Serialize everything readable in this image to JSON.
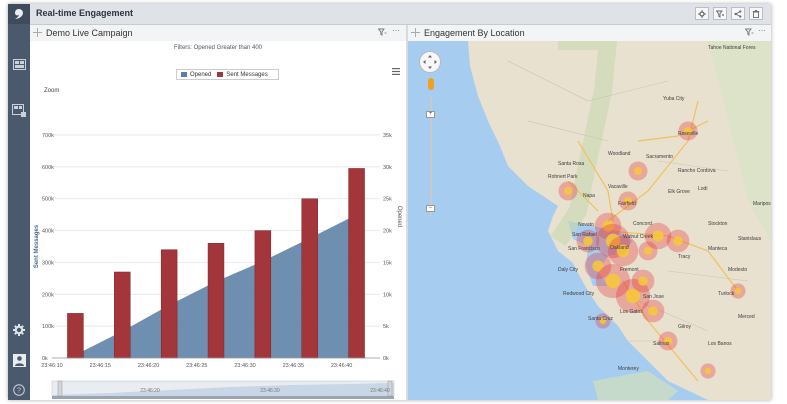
{
  "app": {
    "title": "Real-time Engagement"
  },
  "header_icons": [
    "gear-icon",
    "filter-icon",
    "share-icon",
    "trash-icon"
  ],
  "sidebar": {
    "items": [
      "logo-icon",
      "dashboard-icon",
      "dashboard-add-icon",
      "gear-icon",
      "user-icon",
      "help-icon"
    ]
  },
  "chart_panel": {
    "title": "Demo Live Campaign",
    "filter_text": "Filters: Opened Greater than 400",
    "zoom_label": "Zoom"
  },
  "map_panel": {
    "title": "Engagement By Location"
  },
  "colors": {
    "opened": "#5b7fa6",
    "sent": "#a3363a",
    "sidebar": "#4a5a6c"
  },
  "chart_data": {
    "type": "bar+area",
    "categories": [
      "23:46:10",
      "23:46:15",
      "23:46:20",
      "23:46:25",
      "23:46:30",
      "23:46:35",
      "23:46:40"
    ],
    "x_tick_labels": [
      "23:46:10",
      "23:46:15",
      "23:46:20",
      "23:46:25",
      "23:46:30",
      "23:46:35",
      "23:46:40"
    ],
    "series": [
      {
        "name": "Opened",
        "type": "area",
        "axis": "right",
        "x": [
          "23:46:10",
          "23:46:15",
          "23:46:20",
          "23:46:25",
          "23:46:30",
          "23:46:35",
          "23:46:40"
        ],
        "values": [
          500,
          4200,
          8300,
          12000,
          15200,
          18800,
          22500
        ]
      },
      {
        "name": "Sent Messages",
        "type": "bar",
        "axis": "left",
        "values": [
          140000,
          270000,
          340000,
          360000,
          400000,
          500000,
          595000
        ]
      }
    ],
    "ylabel": "Sent Messages",
    "y2label": "Opened",
    "ylim": [
      0,
      700000
    ],
    "y2lim": [
      0,
      35000
    ],
    "yticks": [
      "0k",
      "100k",
      "200k",
      "300k",
      "400k",
      "500k",
      "600k",
      "700k"
    ],
    "y2ticks": [
      "0k",
      "5k",
      "10k",
      "15k",
      "20k",
      "25k",
      "30k",
      "35k"
    ],
    "navigator_labels": [
      "23:46:20",
      "23:46:30",
      "23:46:40"
    ],
    "legend": "top-center",
    "grid": true
  },
  "map": {
    "labels": [
      "Tahoe National Fores",
      "Yuba City",
      "Roseville",
      "Sacramento",
      "Woodland",
      "Santa Rosa",
      "Rohnert Park",
      "Vacaville",
      "Napa",
      "Fairfield",
      "Rancho Cordova",
      "Elk Grove",
      "Lodi",
      "Stockton",
      "Novato",
      "Walnut Creek",
      "San Rafael",
      "Concord",
      "San Francisco",
      "Oakland",
      "Tracy",
      "Daly City",
      "Fremont",
      "Manteca",
      "Modesto",
      "Turlock",
      "Redwood City",
      "San Jose",
      "Los Gatos",
      "Santa Cruz",
      "Gilroy",
      "Merced",
      "Los Banos",
      "Monterey",
      "Salinas",
      "Stanislaus",
      "Mariposa"
    ]
  }
}
